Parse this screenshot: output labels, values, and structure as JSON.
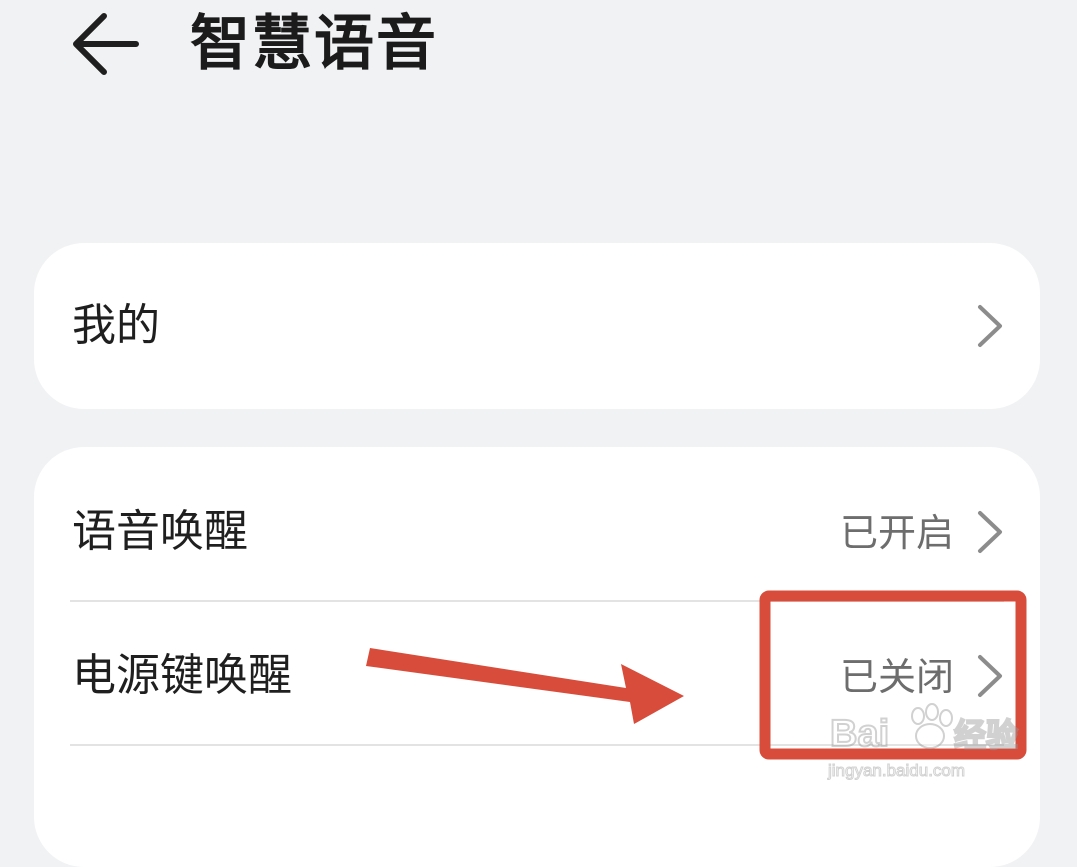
{
  "header": {
    "back_icon": "arrow-left-icon",
    "title": "智慧语音"
  },
  "scroll_fragment": "",
  "sections": {
    "mine": {
      "label": "我的",
      "chevron_icon": "chevron-right-icon"
    },
    "wake": {
      "items": [
        {
          "label": "语音唤醒",
          "value": "已开启",
          "chevron_icon": "chevron-right-icon"
        },
        {
          "label": "电源键唤醒",
          "value": "已关闭",
          "chevron_icon": "chevron-right-icon"
        },
        {
          "label": "",
          "value": "",
          "chevron_icon": "chevron-right-icon"
        }
      ]
    }
  },
  "annotation": {
    "arrow_color": "#d84c3b",
    "highlight_box_color": "#d84c3b"
  },
  "watermark": {
    "text": "Baidu经验",
    "url_text": "jingyan.baidu.com"
  },
  "colors": {
    "background": "#f1f2f4",
    "card": "#ffffff",
    "primary_text": "#1f1f1f",
    "secondary_text": "#6d6d6d",
    "chevron": "#8c8c8c"
  }
}
